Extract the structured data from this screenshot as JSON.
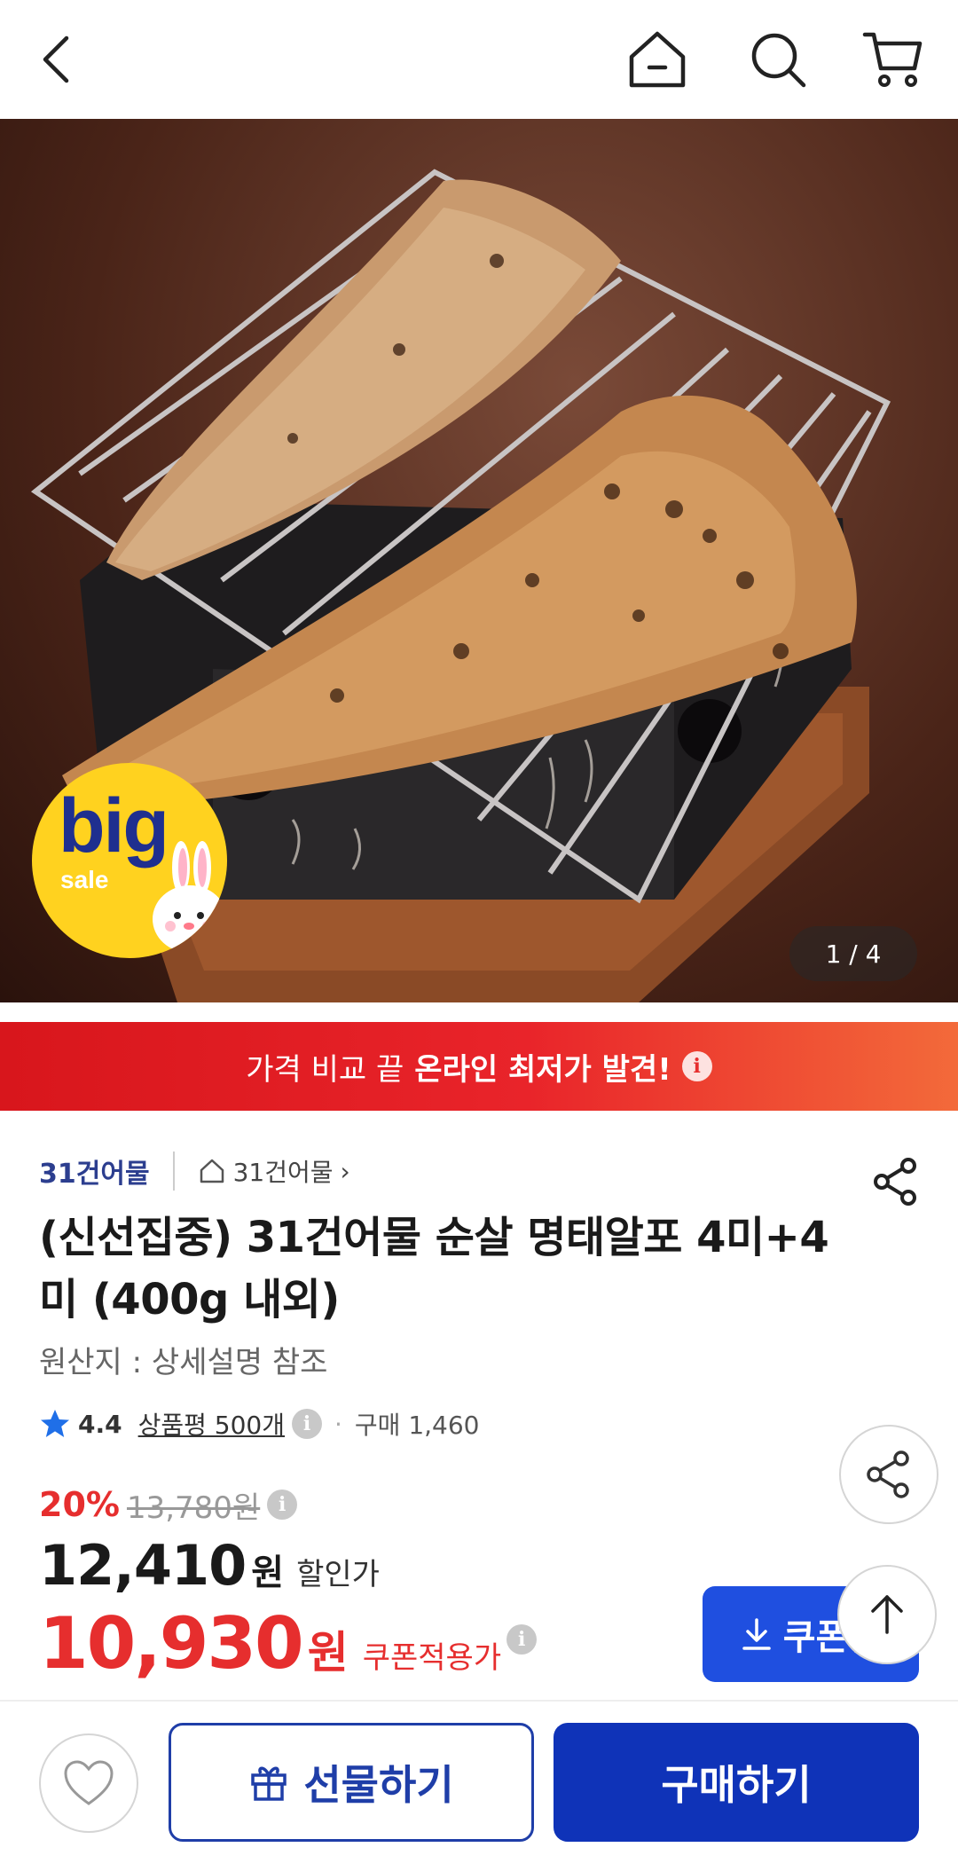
{
  "topbar": {
    "icons": [
      "chevron-left-icon",
      "home-icon",
      "search-icon",
      "cart-icon"
    ]
  },
  "hero": {
    "badge_big": "big",
    "badge_sale": "sale",
    "pager": "1 / 4"
  },
  "banner": {
    "text_normal": "가격 비교 끝",
    "text_bold": "온라인 최저가 발견!",
    "info": "i"
  },
  "brand": {
    "logo": "31건어물",
    "store_name": "31건어물",
    "store_chevron": "›"
  },
  "product": {
    "title": "(신선집중) 31건어물 순살 명태알포 4미+4미 (400g 내외)",
    "origin": "원산지 : 상세설명 참조",
    "rating": "4.4",
    "reviews": "상품평 500개",
    "purchases": "구매 1,460"
  },
  "price": {
    "discount_rate": "20%",
    "original": "13,780원",
    "sale_price": "12,410",
    "sale_unit": "원",
    "sale_label": "할인가",
    "coupon_price": "10,930",
    "coupon_unit": "원",
    "coupon_label": "쿠폰적용가",
    "coupon_button": "쿠폰받"
  },
  "bottombar": {
    "gift_label": "선물하기",
    "buy_label": "구매하기"
  },
  "colors": {
    "accent_red": "#e62e2e",
    "primary_blue": "#0f33b8",
    "coupon_blue": "#1f4fe0",
    "badge_yellow": "#ffd21f"
  }
}
